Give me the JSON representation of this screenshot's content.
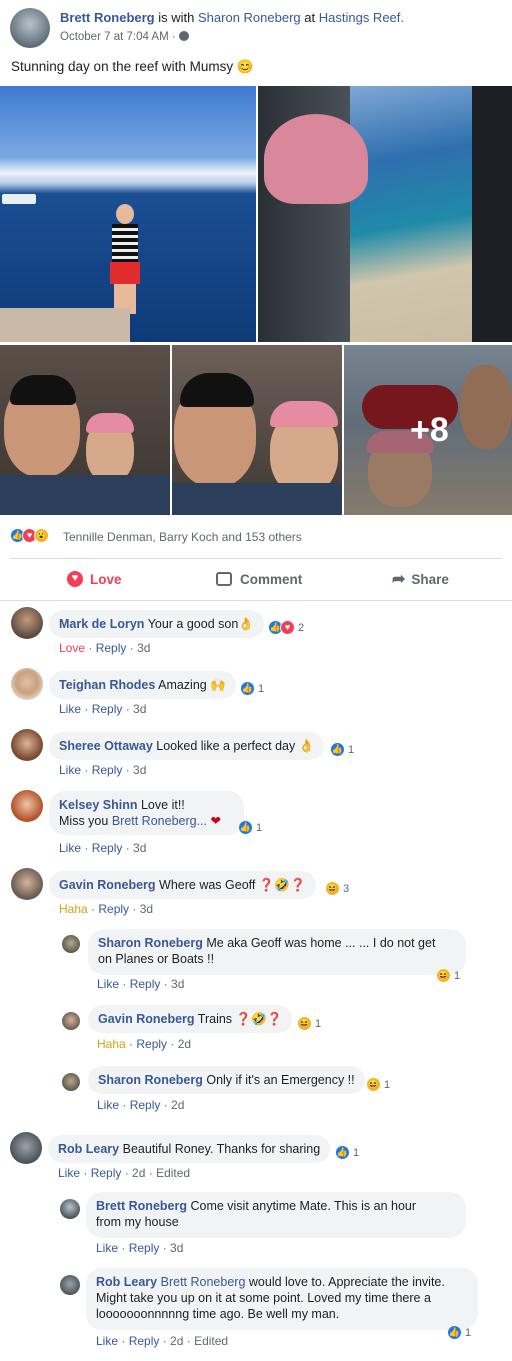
{
  "post": {
    "author": "Brett Roneberg",
    "with_text": "is with",
    "tagged": "Sharon Roneberg",
    "at_text": "at",
    "place": "Hastings Reef.",
    "time": "October 7 at 7:04 AM",
    "privacy_icon": "globe-icon",
    "text": "Stunning day on the reef with Mumsy",
    "text_emoji": "😊",
    "more_photos": "+8"
  },
  "reactions": {
    "icons": [
      "like-icon",
      "love-icon",
      "wow-icon"
    ],
    "summary": "Tennille Denman, Barry Koch and 153 others"
  },
  "actions": {
    "love": "Love",
    "comment": "Comment",
    "share": "Share"
  },
  "colors": {
    "link": "#385898",
    "love": "#f33e58",
    "haha": "#f7b125",
    "like": "#1877f2",
    "bubble": "#f2f3f5"
  },
  "comments": [
    {
      "name": "Mark de Loryn",
      "text": "Your a good son",
      "emoji": "👌",
      "reaction_count": "2",
      "action": "Love",
      "reply": "Reply",
      "age": "3d"
    },
    {
      "name": "Teighan Rhodes",
      "text": "Amazing",
      "emoji": "🙌",
      "reaction_count": "1",
      "action": "Like",
      "reply": "Reply",
      "age": "3d"
    },
    {
      "name": "Sheree Ottaway",
      "text": "Looked like a perfect day",
      "emoji": "👌",
      "reaction_count": "1",
      "action": "Like",
      "reply": "Reply",
      "age": "3d"
    },
    {
      "name": "Kelsey Shinn",
      "text": "Love it!!",
      "text2": "Miss you",
      "tag": "Brett Roneberg...",
      "emoji": "❤",
      "reaction_count": "1",
      "action": "Like",
      "reply": "Reply",
      "age": "3d"
    },
    {
      "name": "Gavin Roneberg",
      "text": "Where was Geoff",
      "emoji": "❓🤣❓",
      "reaction_count": "3",
      "action": "Haha",
      "reply": "Reply",
      "age": "3d"
    },
    {
      "name": "Rob Leary",
      "text": "Beautiful Roney. Thanks for sharing",
      "reaction_count": "1",
      "action": "Like",
      "reply": "Reply",
      "age": "2d",
      "edited": "Edited"
    }
  ],
  "replies": [
    {
      "name": "Sharon Roneberg",
      "text": "Me aka Geoff was home ... ... I do not get",
      "text2": "on Planes or Boats !!",
      "reaction_count": "1",
      "action": "Like",
      "reply": "Reply",
      "age": "3d"
    },
    {
      "name": "Gavin Roneberg",
      "text": "Trains",
      "emoji": "❓🤣❓",
      "reaction_count": "1",
      "action": "Haha",
      "reply": "Reply",
      "age": "2d"
    },
    {
      "name": "Sharon Roneberg",
      "text": "Only if it's an Emergency !!",
      "reaction_count": "1",
      "action": "Like",
      "reply": "Reply",
      "age": "2d"
    },
    {
      "name": "Brett Roneberg",
      "text": "Come visit anytime Mate. This is an hour",
      "text2": "from my house",
      "action": "Like",
      "reply": "Reply",
      "age": "3d"
    },
    {
      "name": "Rob Leary",
      "tag": "Brett Roneberg",
      "text": "would love to. Appreciate the invite.",
      "text2": "Might take you up on it at some point. Loved my time there a",
      "text3": "looooooonnnnng time ago. Be well my man.",
      "reaction_count": "1",
      "action": "Like",
      "reply": "Reply",
      "age": "2d",
      "edited": "Edited"
    }
  ]
}
